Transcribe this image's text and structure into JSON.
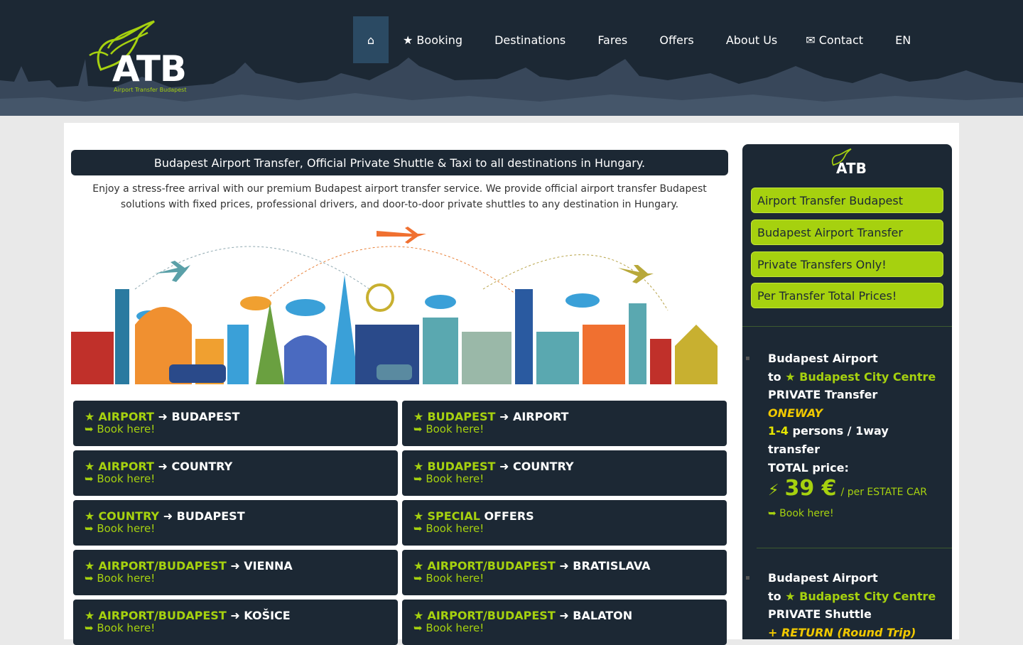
{
  "brand": {
    "logo_text": "ATB",
    "logo_sub": "Airport Transfer Budapest"
  },
  "nav": {
    "home_icon": "⌂",
    "items": [
      "★ Booking",
      "󠀠 Destinations",
      "󠀠 Fares",
      "󠀠 Offers",
      "󠀠 About Us",
      "✉ Contact",
      "󠀠 EN"
    ]
  },
  "main": {
    "banner": "Budapest Airport Transfer, Official Private Shuttle & Taxi to all destinations in Hungary.",
    "intro": "Enjoy a stress-free arrival with our premium Budapest airport transfer service. We provide official airport transfer Budapest solutions with fixed prices, professional drivers, and door-to-door private shuttles to any destination in Hungary.",
    "cards": [
      {
        "from": "AIRPORT",
        "arrow": "➜",
        "to": "BUDAPEST",
        "link": "➥ Book here!"
      },
      {
        "from": "BUDAPEST",
        "arrow": "➜",
        "to": "AIRPORT",
        "link": "➥ Book here!"
      },
      {
        "from": "AIRPORT",
        "arrow": "➜",
        "to": "COUNTRY",
        "link": "➥ Book here!"
      },
      {
        "from": "BUDAPEST",
        "arrow": "➜",
        "to": "COUNTRY",
        "link": "➥ Book here!"
      },
      {
        "from": "COUNTRY",
        "arrow": "➜",
        "to": "BUDAPEST",
        "link": "➥ Book here!"
      },
      {
        "from": "SPECIAL",
        "arrow": "",
        "to": "OFFERS",
        "link": "➥ Book here!"
      },
      {
        "from": "AIRPORT/BUDAPEST",
        "arrow": "➜",
        "to": "VIENNA",
        "link": "➥ Book here!"
      },
      {
        "from": "AIRPORT/BUDAPEST",
        "arrow": "➜",
        "to": "BRATISLAVA",
        "link": "➥ Book here!"
      },
      {
        "from": "AIRPORT/BUDAPEST",
        "arrow": "➜",
        "to": "KOŠICE",
        "link": "➥ Book here!"
      },
      {
        "from": "AIRPORT/BUDAPEST",
        "arrow": "➜",
        "to": "BALATON",
        "link": "➥ Book here!"
      }
    ]
  },
  "sidebar": {
    "logo_text": "ATB",
    "pills": [
      "Airport Transfer Budapest",
      "Budapest Airport Transfer",
      "Private Transfers Only!",
      "Per Transfer Total Prices!"
    ],
    "offer1": {
      "line1": "Budapest Airport",
      "to": "to",
      "dest": "★ Budapest City Centre",
      "type": "PRIVATE Transfer",
      "mode": "ONEWAY",
      "persons_num": "1-4",
      "persons_text": "persons / 1way transfer",
      "total": "TOTAL price:",
      "bolt": "⚡",
      "amount": "39 €",
      "per": "/ per ESTATE CAR",
      "link": "➥ Book here!"
    },
    "offer2": {
      "line1": "Budapest Airport",
      "to": "to",
      "dest": "★ Budapest City Centre",
      "type": "PRIVATE Shuttle",
      "mode": "+ RETURN (Round Trip)"
    }
  },
  "colors": {
    "dark": "#1c2834",
    "accent": "#a6d10f",
    "home_bg": "#2b4a63"
  }
}
